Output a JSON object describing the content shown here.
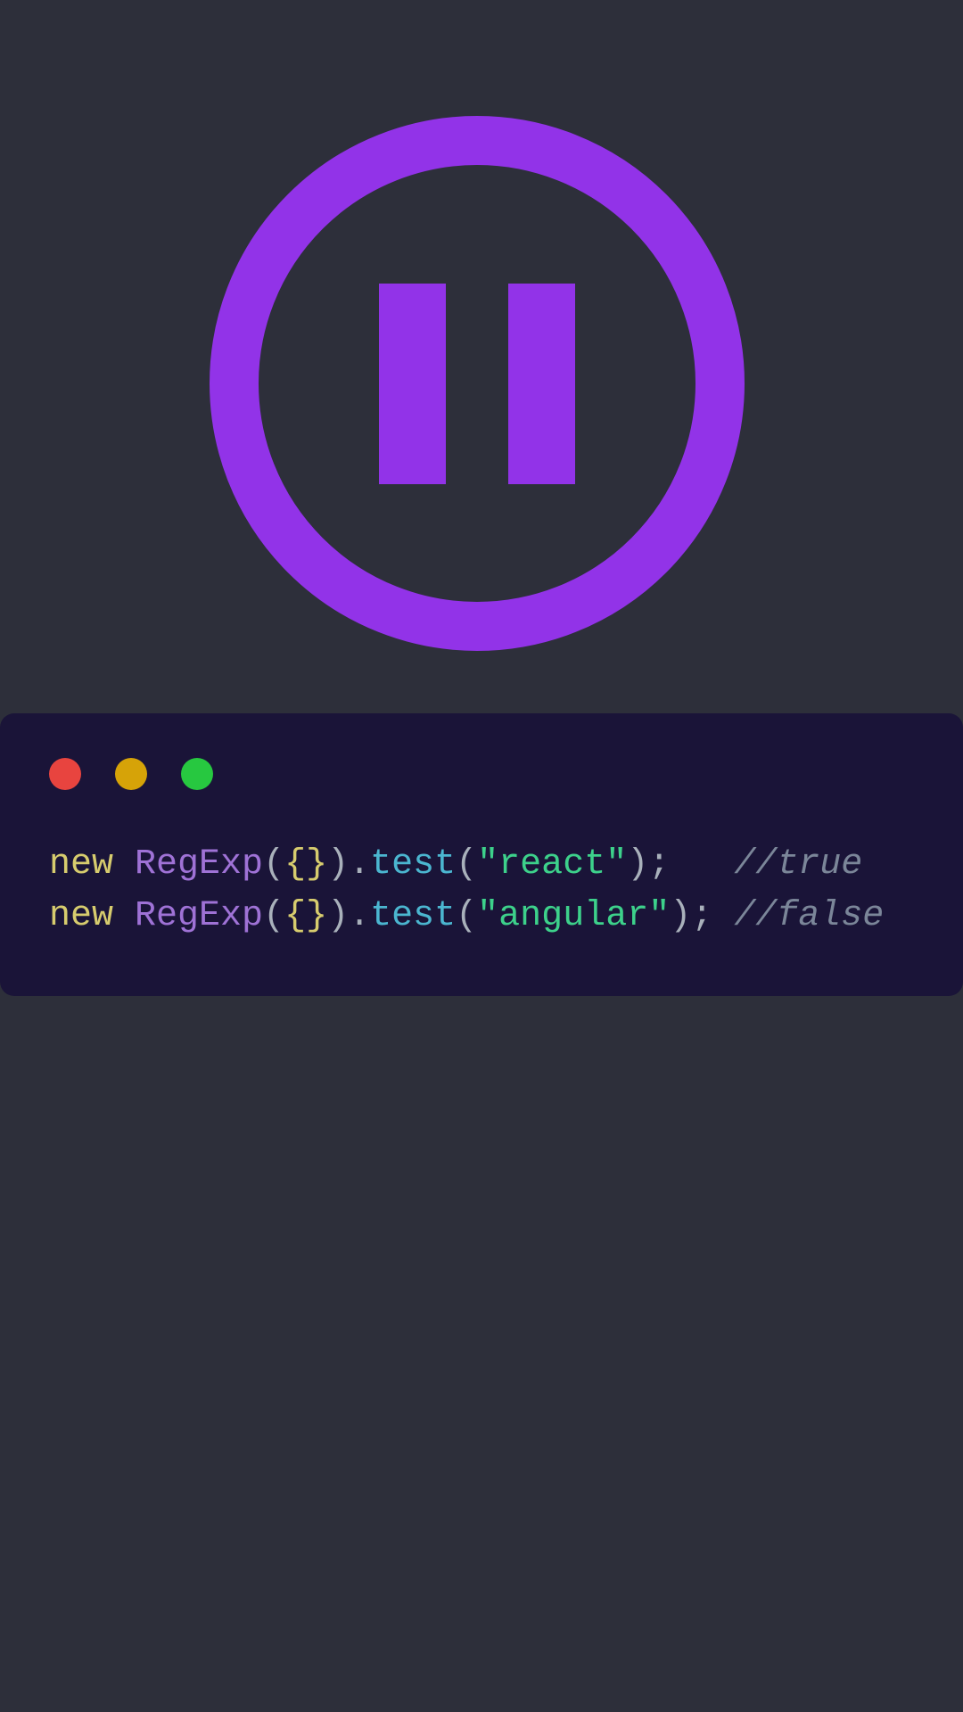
{
  "colors": {
    "purple": "#9233e8",
    "background": "#2d2f3a",
    "codeBg": "#1a1438",
    "red": "#e8443f",
    "yellow": "#d6a308",
    "green": "#27c840"
  },
  "code": {
    "line1": {
      "new": "new",
      "class": "RegExp",
      "parenOpen": "(",
      "braceOpen": "{",
      "braceClose": "}",
      "parenClose": ")",
      "dot": ".",
      "method": "test",
      "parenOpen2": "(",
      "string": "\"react\"",
      "parenClose2": ")",
      "semi": ";",
      "spacing": "   ",
      "comment": "//true"
    },
    "line2": {
      "new": "new",
      "class": "RegExp",
      "parenOpen": "(",
      "braceOpen": "{",
      "braceClose": "}",
      "parenClose": ")",
      "dot": ".",
      "method": "test",
      "parenOpen2": "(",
      "string": "\"angular\"",
      "parenClose2": ")",
      "semi": ";",
      "spacing": " ",
      "comment": "//false"
    }
  }
}
